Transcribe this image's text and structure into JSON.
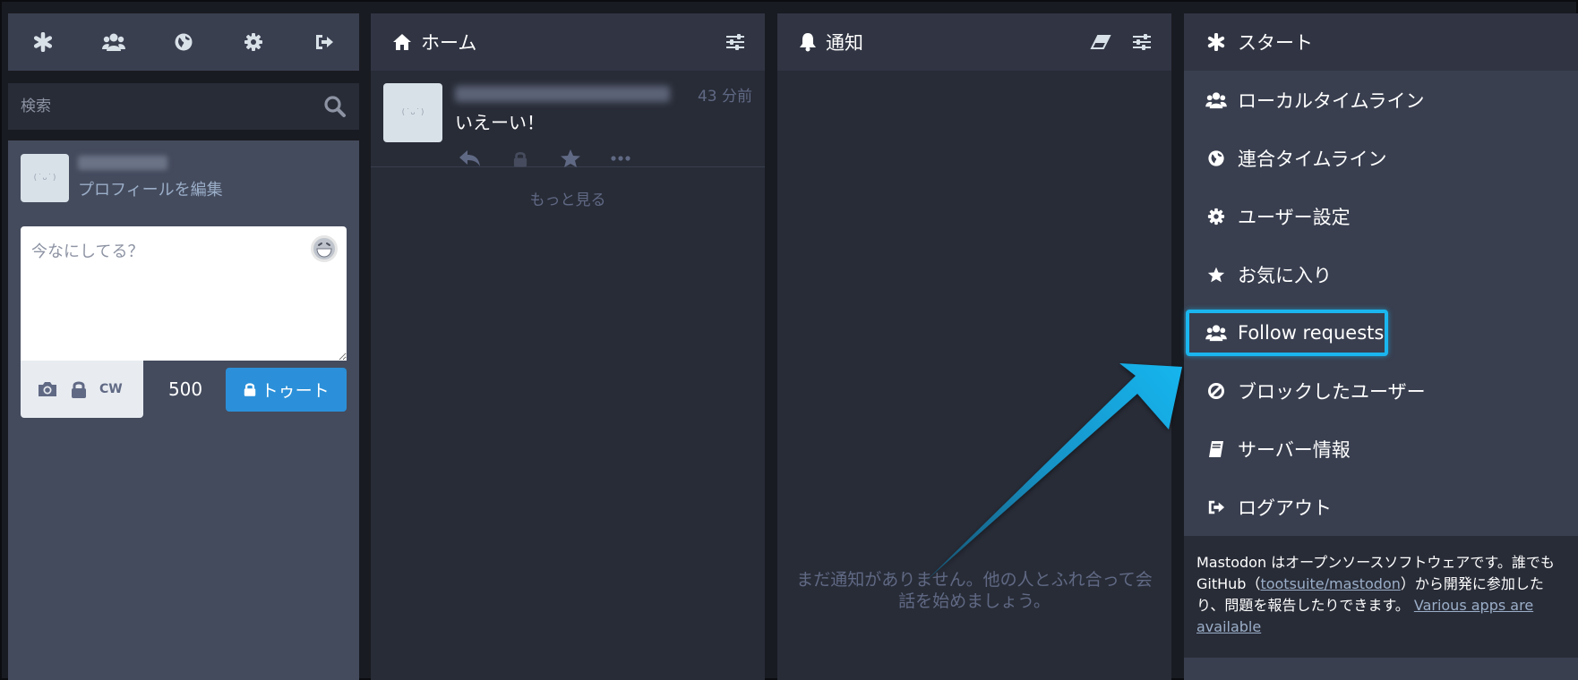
{
  "drawer": {
    "nav_icons": [
      "asterisk-icon",
      "users-icon",
      "globe-icon",
      "gear-icon",
      "sign-out-icon"
    ],
    "search_placeholder": "検索",
    "edit_profile": "プロフィールを編集",
    "compose_placeholder": "今なにしてる？",
    "cw_label": "CW",
    "char_count": "500",
    "toot_label": "トゥート"
  },
  "home": {
    "title": "ホーム",
    "status": {
      "time": "43 分前",
      "content": "いえーい！"
    },
    "load_more": "もっと見る"
  },
  "notifications": {
    "title": "通知",
    "empty_message": "まだ通知がありません。他の人とふれ合って会話を始めましょう。"
  },
  "getting_started": {
    "title": "スタート",
    "items": [
      {
        "label": "ローカルタイムライン",
        "icon": "users-icon"
      },
      {
        "label": "連合タイムライン",
        "icon": "globe-icon"
      },
      {
        "label": "ユーザー設定",
        "icon": "gear-icon"
      },
      {
        "label": "お気に入り",
        "icon": "star-icon"
      },
      {
        "label": "Follow requests",
        "icon": "users-icon"
      },
      {
        "label": "ブロックしたユーザー",
        "icon": "ban-icon"
      },
      {
        "label": "サーバー情報",
        "icon": "book-icon"
      },
      {
        "label": "ログアウト",
        "icon": "sign-out-icon"
      }
    ],
    "footer": {
      "text_1": "Mastodon はオープンソースソフトウェアです。誰でも GitHub（",
      "link_1": "tootsuite/mastodon",
      "text_2": "）から開発に参加したり、問題を報告したりできます。",
      "link_2": "Various apps are available"
    }
  },
  "colors": {
    "accent": "#2b90d9",
    "highlight": "#1ab6ef",
    "background": "#282c37"
  }
}
